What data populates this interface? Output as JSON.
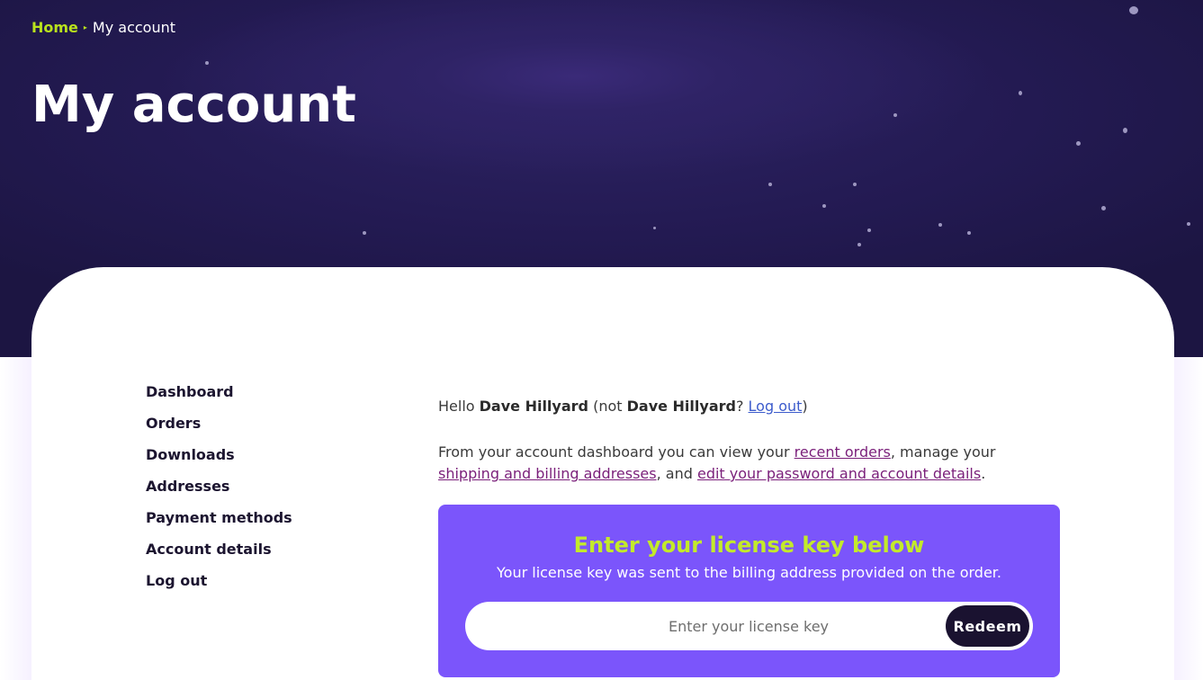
{
  "breadcrumb": {
    "home": "Home",
    "separator": "▸",
    "current": "My account"
  },
  "page": {
    "title": "My account"
  },
  "nav": {
    "items": [
      {
        "label": "Dashboard"
      },
      {
        "label": "Orders"
      },
      {
        "label": "Downloads"
      },
      {
        "label": "Addresses"
      },
      {
        "label": "Payment methods"
      },
      {
        "label": "Account details"
      },
      {
        "label": "Log out"
      }
    ]
  },
  "dashboard": {
    "hello_prefix": "Hello ",
    "user_name": "Dave Hillyard",
    "not_prefix": " (not ",
    "not_name": "Dave Hillyard",
    "question": "? ",
    "logout_link": "Log out",
    "close_paren": ")",
    "intro_prefix": "From your account dashboard you can view your ",
    "recent_orders_link": "recent orders",
    "intro_mid": ", manage your ",
    "addresses_link": "shipping and billing addresses",
    "intro_and": ", and ",
    "account_link": "edit your password and account details",
    "intro_end": "."
  },
  "license": {
    "title": "Enter your license key below",
    "subtitle": "Your license key was sent to the billing address provided on the order.",
    "placeholder": "Enter your license key",
    "value": "",
    "button_label": "Redeem"
  },
  "colors": {
    "hero_bg": "#1c1542",
    "accent_green": "#b9e21d",
    "license_bg": "#7b55fb",
    "button_bg": "#1a1230",
    "link_purple": "#7a1f7a",
    "link_blue": "#3d5ccc"
  }
}
